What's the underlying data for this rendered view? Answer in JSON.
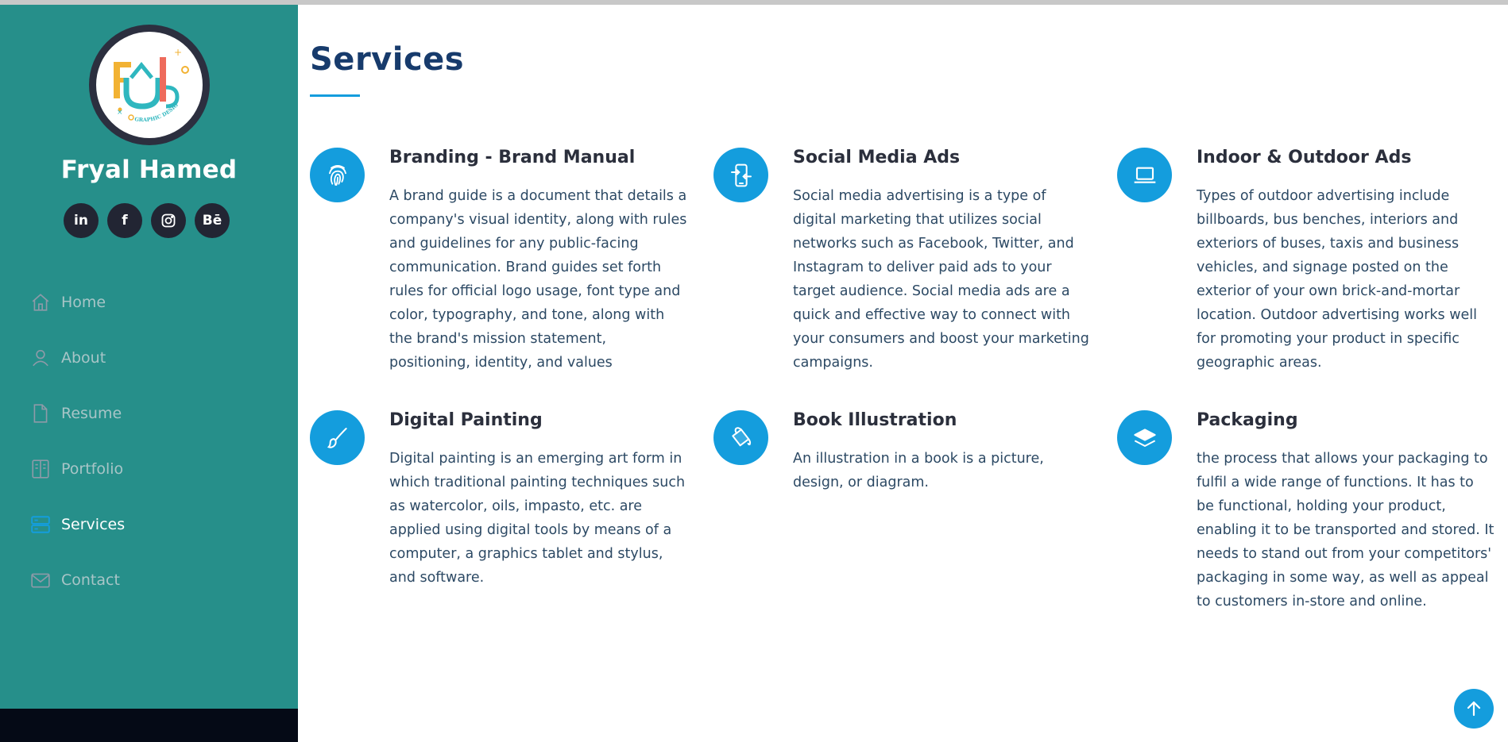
{
  "profile": {
    "name": "Fryal Hamed",
    "logo_text": "GRAPHIC DESIGN"
  },
  "socials": [
    {
      "name": "linkedin",
      "label": "in"
    },
    {
      "name": "facebook",
      "label": "f"
    },
    {
      "name": "instagram",
      "label": ""
    },
    {
      "name": "behance",
      "label": "Bē"
    }
  ],
  "nav": {
    "items": [
      {
        "label": "Home",
        "icon": "house-icon",
        "active": false
      },
      {
        "label": "About",
        "icon": "person-icon",
        "active": false
      },
      {
        "label": "Resume",
        "icon": "file-icon",
        "active": false
      },
      {
        "label": "Portfolio",
        "icon": "book-icon",
        "active": false
      },
      {
        "label": "Services",
        "icon": "server-icon",
        "active": true
      },
      {
        "label": "Contact",
        "icon": "envelope-icon",
        "active": false
      }
    ]
  },
  "main": {
    "title": "Services",
    "services": [
      {
        "icon": "fingerprint-icon",
        "title": "Branding - Brand Manual",
        "description": "A brand guide is a document that details a company's visual identity, along with rules and guidelines for any public-facing communication. Brand guides set forth rules for official logo usage, font type and color, typography, and tone, along with the brand's mission statement, positioning, identity, and values"
      },
      {
        "icon": "phone-transfer-icon",
        "title": "Social Media Ads",
        "description": "Social media advertising is a type of digital marketing that utilizes social networks such as Facebook, Twitter, and Instagram to deliver paid ads to your target audience. Social media ads are a quick and effective way to connect with your consumers and boost your marketing campaigns."
      },
      {
        "icon": "laptop-icon",
        "title": "Indoor & Outdoor Ads",
        "description": "Types of outdoor advertising include billboards, bus benches, interiors and exteriors of buses, taxis and business vehicles, and signage posted on the exterior of your own brick-and-mortar location. Outdoor advertising works well for promoting your product in specific geographic areas."
      },
      {
        "icon": "brush-icon",
        "title": "Digital Painting",
        "description": "Digital painting is an emerging art form in which traditional painting techniques such as watercolor, oils, impasto, etc. are applied using digital tools by means of a computer, a graphics tablet and stylus, and software."
      },
      {
        "icon": "paint-bucket-icon",
        "title": "Book Illustration",
        "description": "An illustration in a book is a picture, design, or diagram."
      },
      {
        "icon": "box-icon",
        "title": "Packaging",
        "description": "the process that allows your packaging to fulfil a wide range of functions. It has to be functional, holding your product, enabling it to be transported and stored. It needs to stand out from your competitors' packaging in some way, as well as appeal to customers in-store and online."
      }
    ]
  },
  "colors": {
    "sidebar": "#268f8a",
    "accent": "#149ddd",
    "heading": "#173b6c",
    "text": "#2c4964"
  }
}
